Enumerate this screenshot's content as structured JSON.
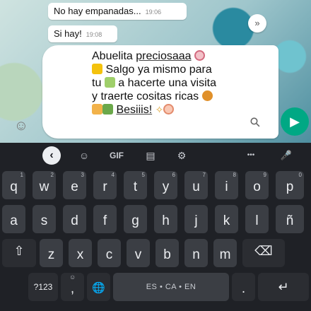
{
  "chat": {
    "messages": [
      {
        "text": "No hay empanadas...",
        "time": "19:06"
      },
      {
        "text": "Si hay!",
        "time": "19:08"
      }
    ],
    "draft_lines": [
      "Abuelita",
      "preciosaaa",
      "Salgo ya mismo para",
      "tu",
      "a hacerte una visita",
      "y traerte cositas ricas",
      "Besiiis!"
    ],
    "emoji_button_icon": "smiley-icon",
    "attach_icon": "paperclip-icon",
    "send_icon": "send-arrow-icon",
    "scroll_icon": "chevron-double-down-icon"
  },
  "keyboard": {
    "toolbar": {
      "back": "‹",
      "sticker": "☺",
      "gif": "GIF",
      "clipboard": "▤",
      "settings": "⚙",
      "more": "•••",
      "mic": "🎤"
    },
    "row1": [
      {
        "key": "q",
        "hint": "1"
      },
      {
        "key": "w",
        "hint": "2"
      },
      {
        "key": "e",
        "hint": "3"
      },
      {
        "key": "r",
        "hint": "4"
      },
      {
        "key": "t",
        "hint": "5"
      },
      {
        "key": "y",
        "hint": "6"
      },
      {
        "key": "u",
        "hint": "7"
      },
      {
        "key": "i",
        "hint": "8"
      },
      {
        "key": "o",
        "hint": "9"
      },
      {
        "key": "p",
        "hint": "0"
      }
    ],
    "row2": [
      "a",
      "s",
      "d",
      "f",
      "g",
      "h",
      "j",
      "k",
      "l",
      "ñ"
    ],
    "row3": [
      "z",
      "x",
      "c",
      "v",
      "b",
      "n",
      "m"
    ],
    "shift": "⇧",
    "backspace": "⌫",
    "symbols": "?123",
    "comma": ",",
    "comma_hint": "☺",
    "globe": "🌐",
    "space_label": "ES • CA • EN",
    "period": ".",
    "enter": "↵"
  },
  "colors": {
    "keyboard_bg": "#1f2126",
    "key_bg": "#3b3e44",
    "send": "#00a884"
  }
}
